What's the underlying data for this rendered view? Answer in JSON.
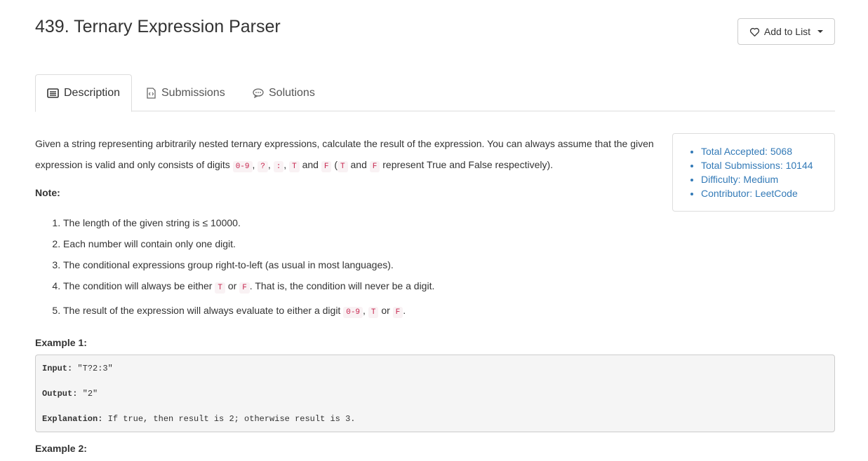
{
  "problem": {
    "title": "439. Ternary Expression Parser",
    "add_to_list": "Add to List"
  },
  "tabs": [
    {
      "label": "Description",
      "icon": "list-icon"
    },
    {
      "label": "Submissions",
      "icon": "code-file-icon"
    },
    {
      "label": "Solutions",
      "icon": "comment-icon"
    }
  ],
  "description": {
    "p1_part1": "Given a string representing arbitrarily nested ternary expressions, calculate the result of the expression. You can always assume that the given expression is valid and only consists of digits ",
    "code_digits": "0-9",
    "code_q": "?",
    "code_colon": ":",
    "code_T": "T",
    "code_F": "F",
    "and_word": "and",
    "or_word": "or",
    "represent_text": "represent True and False respectively).",
    "note_label": "Note:",
    "notes": [
      "The length of the given string is ≤ 10000.",
      "Each number will contain only one digit.",
      "The conditional expressions group right-to-left (as usual in most languages).",
      "The condition will always be either",
      "The result of the expression will always evaluate to either a digit"
    ],
    "note4_tail": ". That is, the condition will never be a digit.",
    "example1_label": "Example 1:",
    "example2_label": "Example 2:"
  },
  "example1": {
    "input_key": "Input:",
    "input_val": " \"T?2:3\"",
    "output_key": "Output:",
    "output_val": " \"2\"",
    "explanation_key": "Explanation:",
    "explanation_val": " If true, then result is 2; otherwise result is 3."
  },
  "stats": {
    "accepted": "Total Accepted: 5068",
    "submissions": "Total Submissions: 10144",
    "difficulty": "Difficulty: Medium",
    "contributor": "Contributor: LeetCode"
  }
}
